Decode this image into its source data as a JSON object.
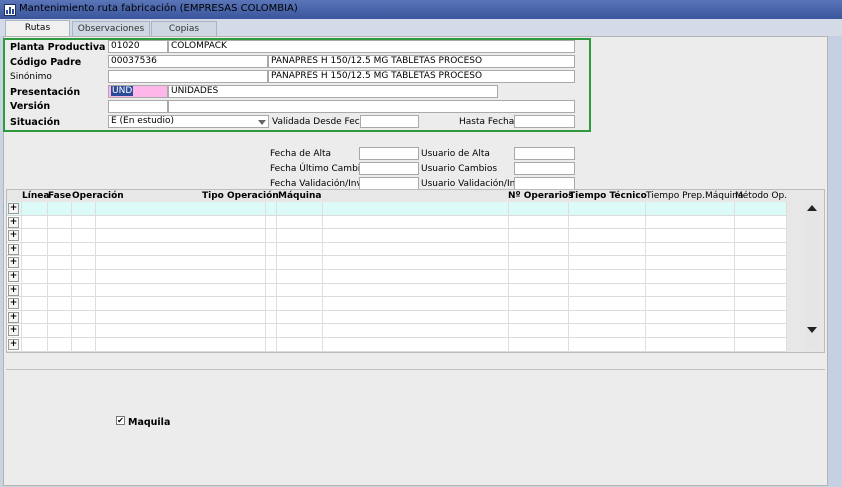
{
  "window": {
    "title": "Mantenimiento ruta fabricación (EMPRESAS COLOMBIA)"
  },
  "tabs": [
    {
      "label": "Rutas"
    },
    {
      "label": "Observaciones"
    },
    {
      "label": "Copias"
    }
  ],
  "form": {
    "planta_label": "Planta Productiva",
    "planta_code": "01020",
    "planta_name": "COLOMPACK",
    "codigo_label": "Código Padre",
    "codigo_value": "00037536",
    "codigo_desc": "PANAPRES H 150/12.5 MG TABLETAS PROCESO",
    "sinonimo_label": "Sinónimo",
    "sinonimo_value": "",
    "sinonimo_desc": "PANAPRES H 150/12.5 MG TABLETAS PROCESO",
    "presentacion_label": "Presentación",
    "presentacion_code": "UND",
    "presentacion_desc": "UNIDADES",
    "version_label": "Versión",
    "version_value": "",
    "version_desc": "",
    "situacion_label": "Situación",
    "situacion_value": "E (En estudio)",
    "validada_label": "Validada Desde Fecha",
    "validada_value": "",
    "hasta_label": "Hasta Fecha",
    "hasta_value": ""
  },
  "audit": {
    "fecha_alta_label": "Fecha de Alta",
    "fecha_ultimo_label": "Fecha Último Cambio",
    "fecha_validacion_label": "Fecha Validación/Inv.",
    "usuario_alta_label": "Usuario de Alta",
    "usuario_cambios_label": "Usuario Cambios",
    "usuario_validacion_label": "Usuario Validación/Inv."
  },
  "grid": {
    "columns": [
      "Línea",
      "Fase",
      "Operación",
      "Tipo Operación",
      "Máquina",
      "Nº Operarios",
      "Tiempo Técnico",
      "Tiempo Prep.Máquina",
      "Método Op."
    ],
    "expand_symbol": "+"
  },
  "maquila": {
    "label": "Maquila",
    "checked": true,
    "check_symbol": "✔"
  }
}
